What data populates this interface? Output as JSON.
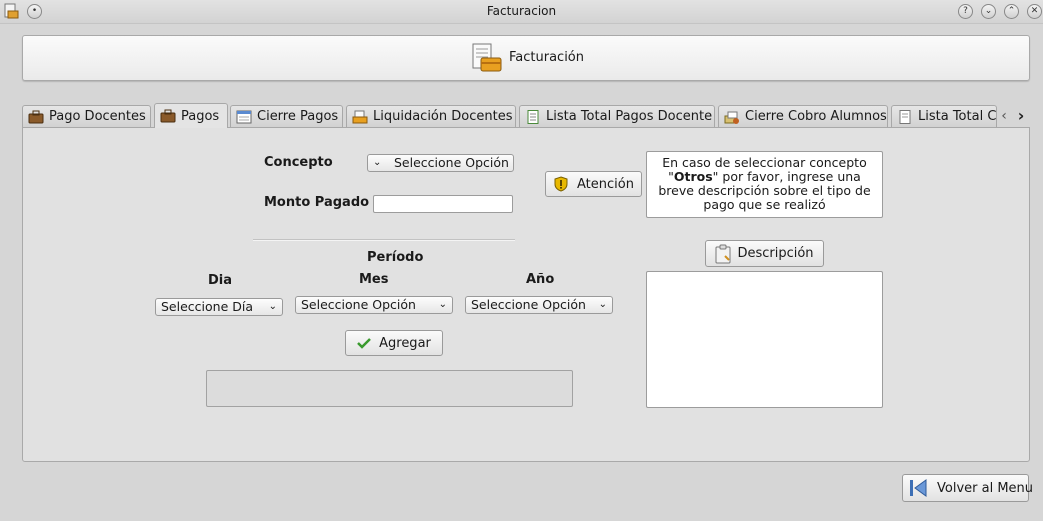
{
  "window": {
    "title": "Facturacion",
    "buttons": [
      {
        "name": "help",
        "glyph": "?"
      },
      {
        "name": "minimize",
        "glyph": "⌄"
      },
      {
        "name": "maximize",
        "glyph": "⌃"
      },
      {
        "name": "close",
        "glyph": "✕"
      }
    ]
  },
  "header": {
    "title": "Facturación",
    "icon": "invoice-icon"
  },
  "tabs": [
    {
      "label": "Pago Docentes",
      "icon": "briefcase-icon"
    },
    {
      "label": "Pagos",
      "icon": "briefcase-icon"
    },
    {
      "label": "Cierre Pagos",
      "icon": "calendar-icon"
    },
    {
      "label": "Liquidación Docentes",
      "icon": "folder-icon"
    },
    {
      "label": "Lista Total Pagos Docente",
      "icon": "document-icon"
    },
    {
      "label": "Cierre Cobro Alumnos",
      "icon": "chart-icon"
    },
    {
      "label": "Lista Total Cobro",
      "icon": "document-icon"
    }
  ],
  "active_tab": "Pagos",
  "form": {
    "concepto_label": "Concepto",
    "concepto_value": "Seleccione Opción",
    "monto_label": "Monto Pagado",
    "monto_value": "",
    "periodo_label": "Período",
    "dia_label": "Dia",
    "mes_label": "Mes",
    "anio_label": "Año",
    "dia_value": "Seleccione Día",
    "mes_value": "Seleccione Opción",
    "anio_value": "Seleccione Opción",
    "agregar_label": "Agregar",
    "periods_list": []
  },
  "notice": {
    "button_label": "Atención",
    "text_pre": "En caso de seleccionar concepto \"",
    "text_bold": "Otros",
    "text_post": "\" por favor, ingrese una breve descripción sobre el tipo de pago que se realizó"
  },
  "description": {
    "button_label": "Descripción",
    "value": ""
  },
  "footer": {
    "back_label": "Volver al Menu"
  },
  "colors": {
    "accept_green": "#3a9a2e",
    "warning_yellow": "#e8b800",
    "nav_blue": "#3d6fb5"
  }
}
